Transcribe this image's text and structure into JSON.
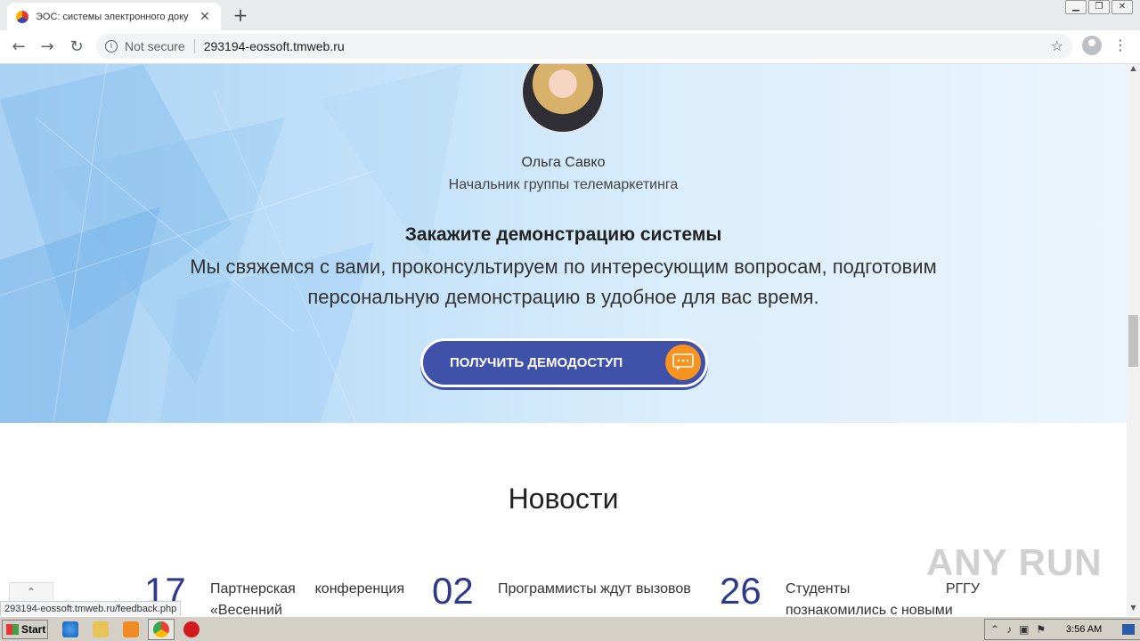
{
  "browser": {
    "tab_title": "ЭОС: системы электронного доку",
    "tab_close": "✕",
    "new_tab": "+",
    "not_secure": "Not secure",
    "url": "293194-eossoft.tmweb.ru",
    "status_link": "293194-eossoft.tmweb.ru/feedback.php"
  },
  "hero": {
    "person_name": "Ольга Савко",
    "person_role": "Начальник группы телемаркетинга",
    "cta_title": "Закажите демонстрацию системы",
    "cta_text": "Мы свяжемся с вами, проконсультируем по интересующим вопросам, подготовим персональную демонстрацию в удобное для вас время.",
    "demo_button": "ПОЛУЧИТЬ ДЕМОДОСТУП"
  },
  "news": {
    "title": "Новости",
    "items": [
      {
        "day": "17",
        "text": "Партнерская конференция «Весенний"
      },
      {
        "day": "02",
        "text": "Программисты ждут вызовов"
      },
      {
        "day": "26",
        "text": "Студенты РГГУ познакомились с новыми"
      }
    ]
  },
  "watermark": "ANY RUN",
  "taskbar": {
    "start_label": "Start",
    "clock": "3:56 AM"
  },
  "colors": {
    "accent": "#3f51a8",
    "chat_orange": "#f7931e",
    "news_day": "#2d3a8c"
  }
}
